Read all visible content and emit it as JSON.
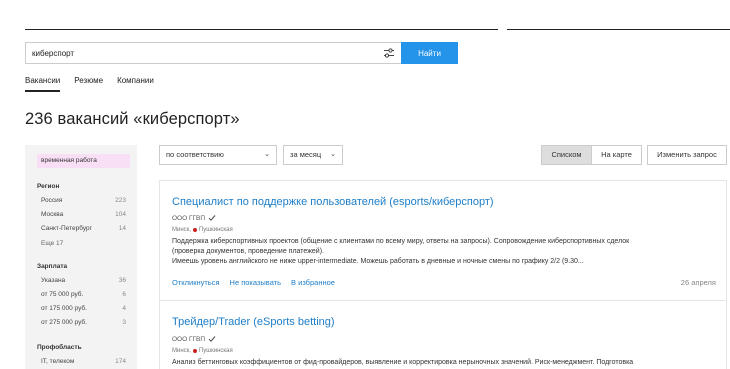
{
  "search": {
    "value": "киберспорт",
    "button": "Найти"
  },
  "tabs": [
    {
      "label": "Вакансии"
    },
    {
      "label": "Резюме"
    },
    {
      "label": "Компании"
    }
  ],
  "page_title": "236 вакансий «киберспорт»",
  "sidebar": {
    "chip": "временная работа",
    "region": {
      "heading": "Регион",
      "items": [
        {
          "label": "Россия",
          "count": "223"
        },
        {
          "label": "Москва",
          "count": "104"
        },
        {
          "label": "Санкт-Петербург",
          "count": "14"
        }
      ],
      "more": "Еще 17"
    },
    "salary": {
      "heading": "Зарплата",
      "items": [
        {
          "label": "Указана",
          "count": "36"
        },
        {
          "label": "от 75 000 руб.",
          "count": "6"
        },
        {
          "label": "от 175 000 руб.",
          "count": "4"
        },
        {
          "label": "от 275 000 руб.",
          "count": "3"
        }
      ]
    },
    "profarea": {
      "heading": "Профобласть",
      "items": [
        {
          "label": "IT, телеком",
          "count": "174"
        }
      ]
    }
  },
  "filters": {
    "sort": "по соответствию",
    "period": "за месяц"
  },
  "view": {
    "list": "Списком",
    "map": "На карте",
    "edit": "Изменить запрос"
  },
  "vacancies": [
    {
      "title": "Специалист по поддержке пользователей (esports/киберспорт)",
      "company": "ООО ГГВП",
      "location": "Минск,",
      "metro": "Пушкинская",
      "desc1": "Поддержка киберспортивных проектов (общение с клиентами по всему миру, ответы на запросы). Сопровождение киберспортивных сделок",
      "desc2": "(проверка документов, проведение платежей).",
      "desc3": "Имеешь уровень английского не ниже upper-intermediate. Можешь работать в дневные и ночные смены по графику 2/2 (9.30...",
      "respond": "Откликнуться",
      "hide": "Не показывать",
      "favorite": "В избранное",
      "date": "26 апреля"
    },
    {
      "title": "Трейдер/Trader (eSports betting)",
      "company": "ООО ГГВП",
      "location": "Минск,",
      "metro": "Пушкинская",
      "desc1": "Анализ беттинговых коэффициентов от фид-провайдеров, выявление и корректировка нерыночных значений. Риск-менеджмент. Подготовка"
    }
  ]
}
